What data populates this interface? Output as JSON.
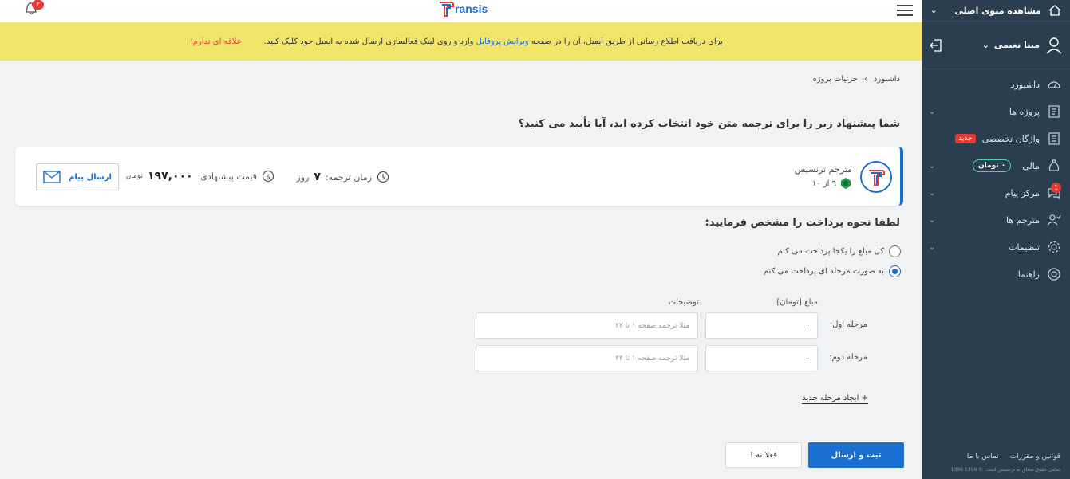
{
  "sidebar": {
    "top_label": "مشاهده منوی اصلی",
    "user_name": "مینا نعیمی",
    "items": [
      {
        "label": "داشبورد"
      },
      {
        "label": "پروژه ها"
      },
      {
        "label": "واژگان تخصصی",
        "badge": "جدید"
      },
      {
        "label": "مالی",
        "badge": "۰ تومان"
      },
      {
        "label": "مرکز پیام",
        "badge": "1"
      },
      {
        "label": "مترجم ها"
      },
      {
        "label": "تنظیمات"
      },
      {
        "label": "راهنما"
      }
    ],
    "footer_links": [
      "قوانین و مقررات",
      "تماس با ما"
    ],
    "copyright": "تمامی حقوق متعلق به ترنسیس است. © 1398 1396"
  },
  "header": {
    "logo_text": "ransis",
    "notif_count": "۳"
  },
  "alert": {
    "text_before": "برای دریافت اطلاع رسانی از طریق ایمیل، آن را در صفحه",
    "link": "ویرایش پروفایل",
    "text_after": "وارد و روی لینک فعالسازی ارسال شده به ایمیل خود کلیک کنید.",
    "deny": "علاقه ای ندارم!"
  },
  "breadcrumb": {
    "home": "داشبورد",
    "sep": "›",
    "current": "جزئیات پروژه"
  },
  "question": "شما پیشنهاد زیر را برای ترجمه متن خود انتخاب کرده اید، آیا تأیید می کنید؟",
  "offer": {
    "translator_name": "مترجم ترنسیس",
    "rating": "۹ از ۱۰",
    "time_label": "زمان ترجمه:",
    "time_value": "۷",
    "time_unit": "روز",
    "price_label": "قیمت پیشنهادی:",
    "price_value": "۱۹۷,۰۰۰",
    "price_unit": "تومان",
    "message_button": "ارسال پیام"
  },
  "payment": {
    "title": "لطفا نحوه پرداخت را مشخص فرمایید:",
    "option_full": "کل مبلغ را یکجا پرداخت می کنم",
    "option_stages": "به صورت مرحله ای پرداخت می کنم",
    "selected": "stages",
    "col_amount": "مبلغ [تومان]",
    "col_desc": "توضیحات",
    "stages": [
      {
        "label": "مرحله اول:",
        "amount": "۰",
        "desc_placeholder": "مثلا ترجمه صفحه ۱ تا ۲۲"
      },
      {
        "label": "مرحله دوم:",
        "amount": "۰",
        "desc_placeholder": "مثلا ترجمه صفحه ۱ تا ۲۲"
      }
    ],
    "new_stage": "+ ایجاد مرحله جدید"
  },
  "actions": {
    "submit": "ثبت و ارسال",
    "cancel": "فعلا نه !"
  },
  "colors": {
    "primary": "#1a6fd1",
    "sidebar": "#2b3e50",
    "alert_bg": "#f2e56b",
    "danger": "#e53935"
  }
}
